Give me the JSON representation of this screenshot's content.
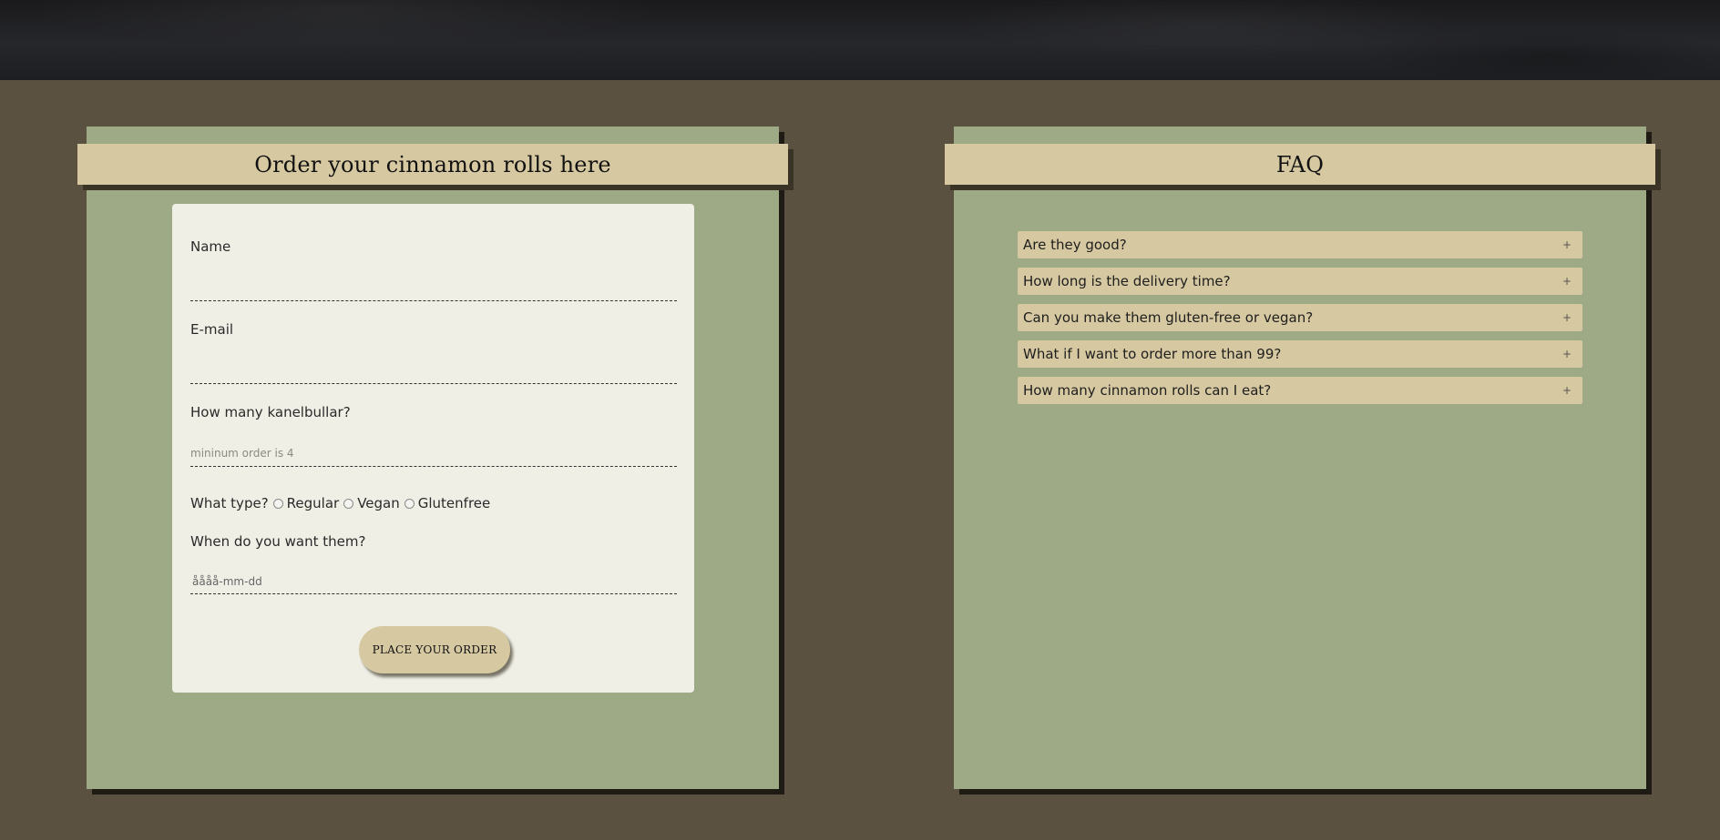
{
  "order": {
    "title": "Order your cinnamon rolls here",
    "name_label": "Name",
    "email_label": "E-mail",
    "quantity_label": "How many kanelbullar?",
    "quantity_placeholder": "mininum order is 4",
    "type_label": "What type?",
    "type_options": [
      "Regular",
      "Vegan",
      "Glutenfree"
    ],
    "date_label": "When do you want them?",
    "date_placeholder": "åååå-mm-dd",
    "submit_label": "PLACE YOUR ORDER"
  },
  "faq": {
    "title": "FAQ",
    "toggle_symbol": "+",
    "items": [
      "Are they good?",
      "How long is the delivery time?",
      "Can you make them gluten-free or vegan?",
      "What if I want to order more than 99?",
      "How many cinnamon rolls can I eat?"
    ]
  },
  "colors": {
    "page_bg": "#5a5140",
    "panel_bg": "#9eaa86",
    "accent_tan": "#d6c8a1",
    "card_bg": "#f0efe6"
  }
}
